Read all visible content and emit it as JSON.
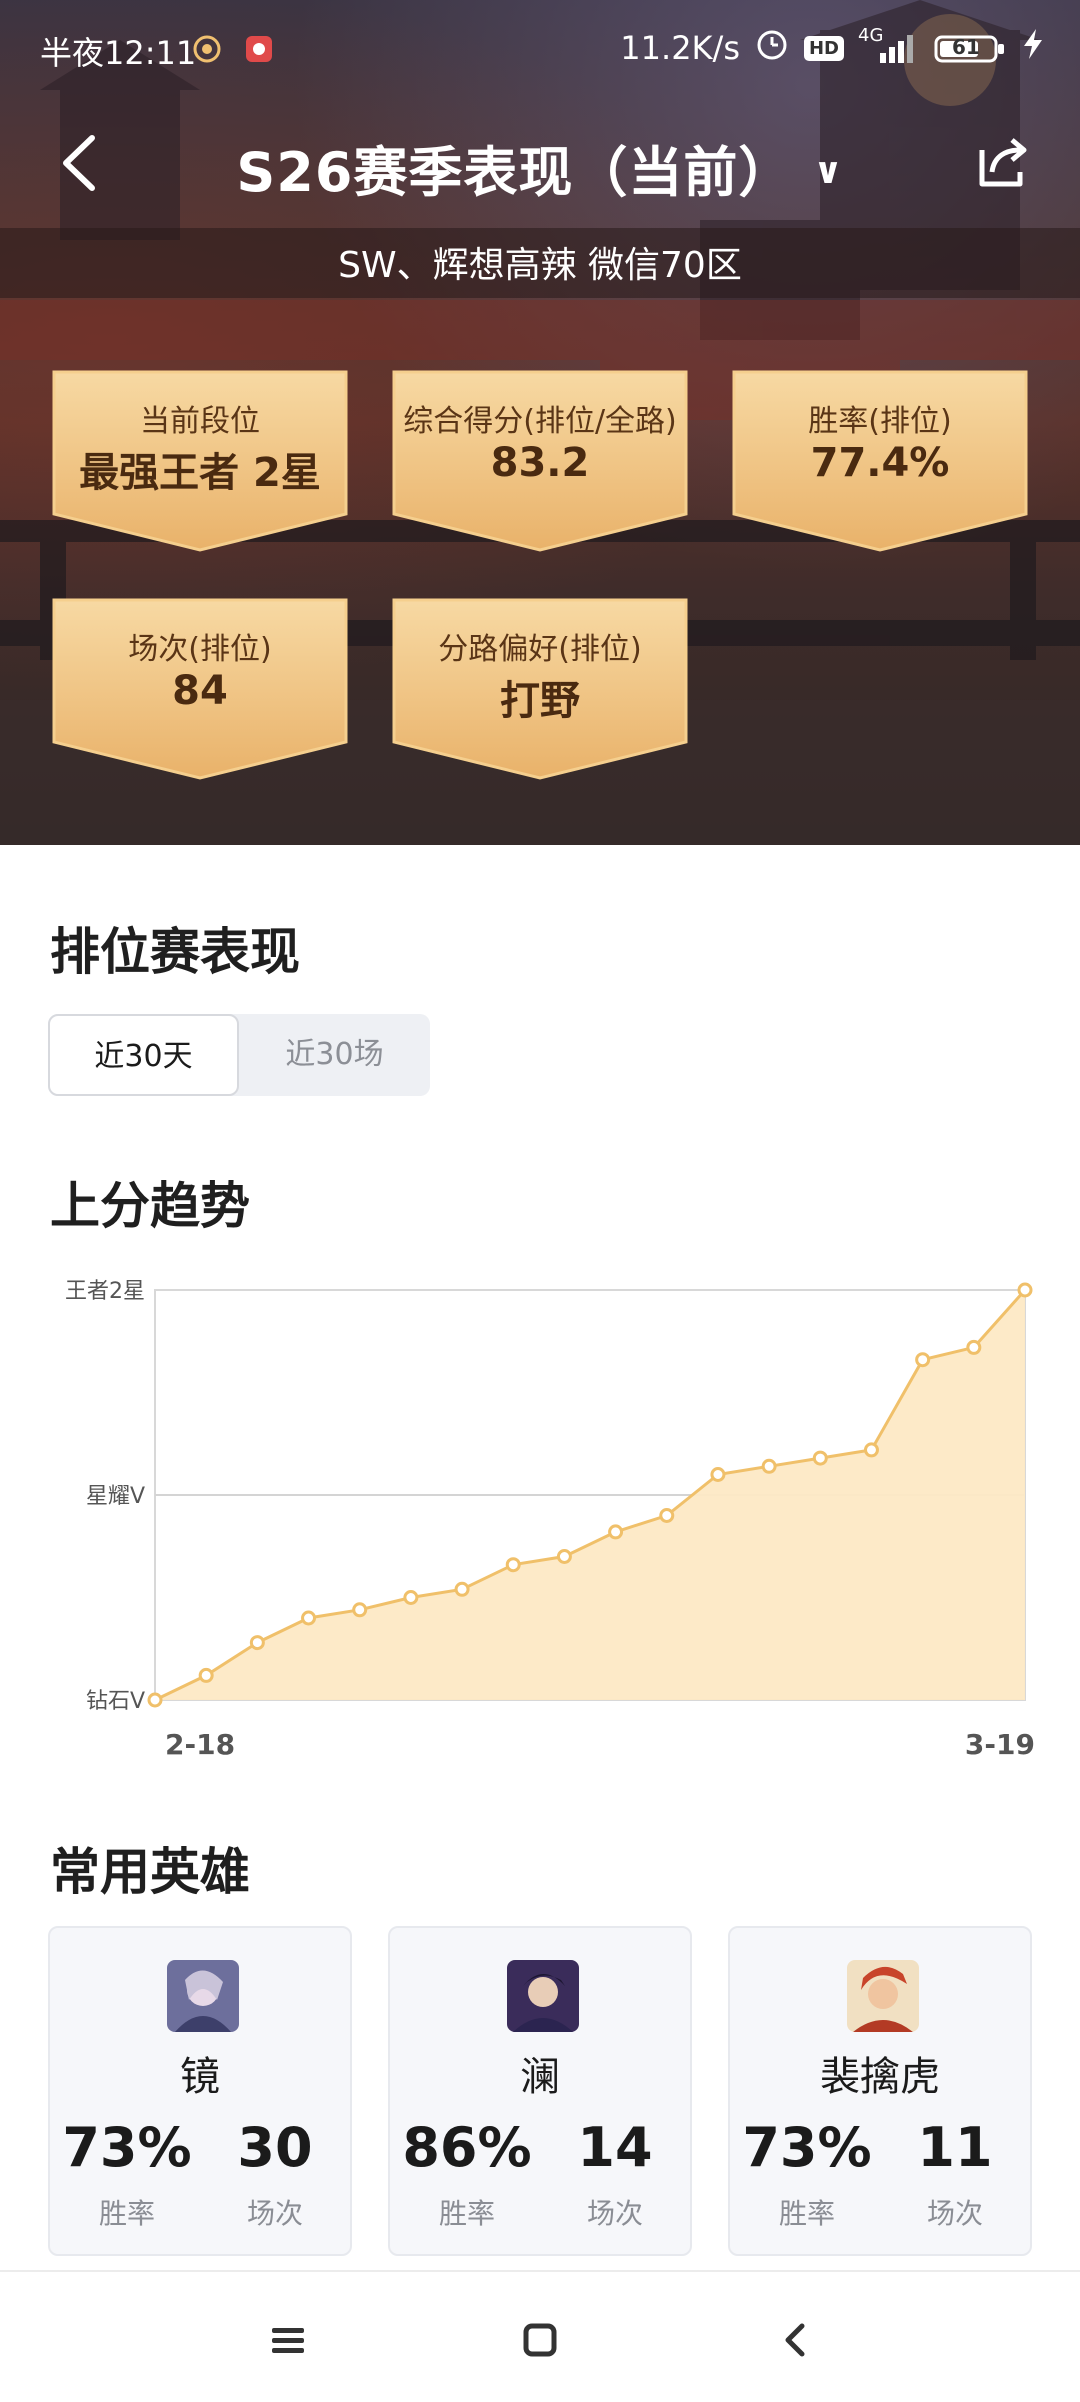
{
  "status_bar": {
    "time": "半夜12:11",
    "net_speed": "11.2K/s",
    "hd": "HD",
    "signal": "4G",
    "battery": "61"
  },
  "header": {
    "title": "S26赛季表现（当前）",
    "subtitle": "SW、辉想高辣  微信70区"
  },
  "cards": [
    {
      "label": "当前段位",
      "value": "最强王者 2星"
    },
    {
      "label": "综合得分(排位/全路)",
      "value": "83.2"
    },
    {
      "label": "胜率(排位)",
      "value": "77.4%"
    },
    {
      "label": "场次(排位)",
      "value": "84"
    },
    {
      "label": "分路偏好(排位)",
      "value": "打野"
    }
  ],
  "ranked": {
    "title": "排位赛表现",
    "tabs": [
      {
        "label": "近30天",
        "active": true
      },
      {
        "label": "近30场",
        "active": false
      }
    ]
  },
  "trend": {
    "title": "上分趋势"
  },
  "chart_data": {
    "type": "area",
    "y_ticks": [
      "钻石V",
      "星耀V",
      "王者2星"
    ],
    "ylim": [
      0,
      100
    ],
    "x_start_label": "2-18",
    "x_end_label": "3-19",
    "values": [
      0,
      6,
      14,
      20,
      22,
      25,
      27,
      33,
      35,
      41,
      45,
      55,
      57,
      59,
      61,
      83,
      86,
      100
    ],
    "color": "#f0c06a",
    "fill": "#fde9c5",
    "grid": true
  },
  "heroes_section": {
    "title": "常用英雄"
  },
  "heroes": [
    {
      "name": "镜",
      "winrate": "73%",
      "winrate_label": "胜率",
      "games": "30",
      "games_label": "场次"
    },
    {
      "name": "澜",
      "winrate": "86%",
      "winrate_label": "胜率",
      "games": "14",
      "games_label": "场次"
    },
    {
      "name": "裴擒虎",
      "winrate": "73%",
      "winrate_label": "胜率",
      "games": "11",
      "games_label": "场次"
    }
  ]
}
